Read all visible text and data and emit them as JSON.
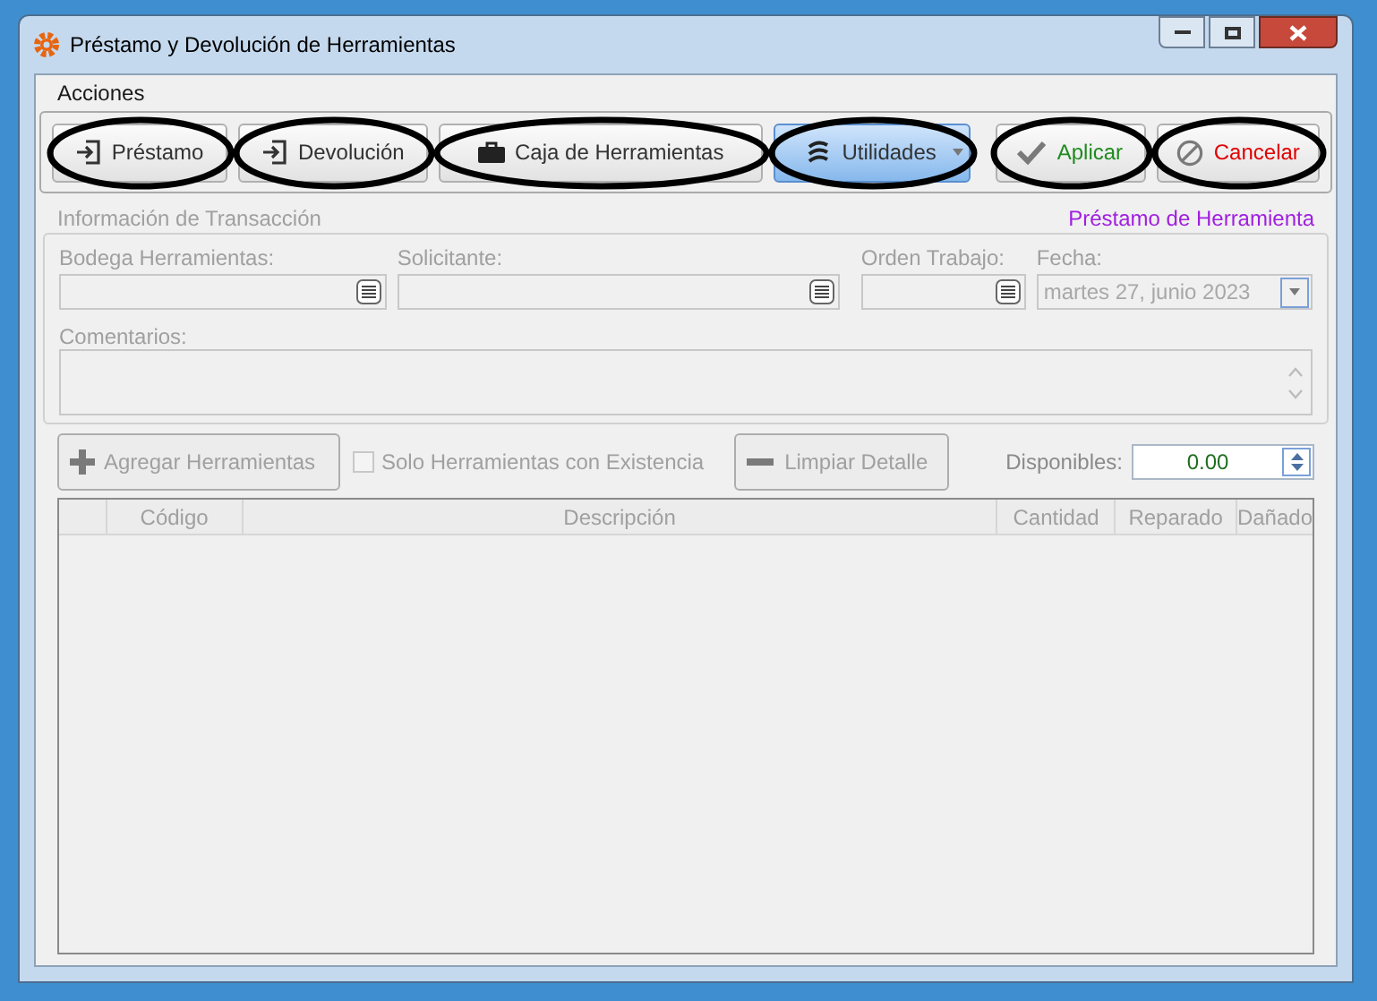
{
  "window": {
    "title": "Préstamo y Devolución de Herramientas"
  },
  "menu": [
    "Acciones"
  ],
  "toolbar": [
    {
      "label": "Préstamo",
      "kind": "loan",
      "selected": false,
      "highlighted": true
    },
    {
      "label": "Devolución",
      "kind": "return",
      "selected": false,
      "highlighted": true
    },
    {
      "label": "Caja de Herramientas",
      "kind": "toolbox",
      "selected": false,
      "highlighted": true
    },
    {
      "label": "Utilidades",
      "kind": "utilities",
      "selected": true,
      "highlighted": true
    },
    {
      "label": "Aplicar",
      "kind": "apply",
      "selected": false,
      "highlighted": true
    },
    {
      "label": "Cancelar",
      "kind": "cancel",
      "selected": false,
      "highlighted": true
    }
  ],
  "section": {
    "title": "Información de Transacción",
    "mode": "Préstamo de Herramienta"
  },
  "fields": [
    {
      "label": "Bodega Herramientas:",
      "kind": "lookup"
    },
    {
      "label": "Solicitante:",
      "kind": "lookup"
    },
    {
      "label": "Orden Trabajo:",
      "kind": "lookup"
    },
    {
      "label": "Fecha:",
      "kind": "date",
      "value": "martes 27, junio 2023"
    }
  ],
  "comments": {
    "label": "Comentarios:"
  },
  "detail_bar": {
    "add_button": {
      "label": "Agregar Herramientas",
      "disabled": true
    },
    "stock_only": {
      "label": "Solo Herramientas con Existencia",
      "checked": false,
      "disabled": true
    },
    "clear_button": {
      "label": "Limpiar Detalle"
    },
    "available": {
      "label": "Disponibles:",
      "value": "0.00"
    }
  },
  "table": {
    "columns": [
      "",
      "Código",
      "Descripción",
      "Cantidad",
      "Reparado",
      "Dañado"
    ]
  }
}
